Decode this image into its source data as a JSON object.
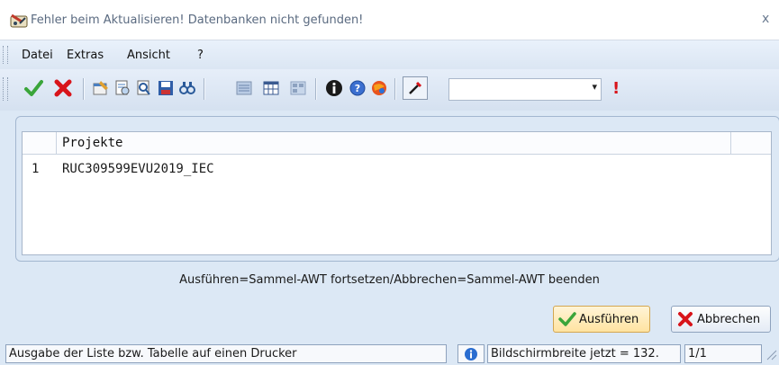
{
  "window": {
    "title": "Fehler beim Aktualisieren! Datenbanken nicht gefunden!",
    "close_glyph": "x"
  },
  "menu": {
    "items": [
      "Datei",
      "Extras",
      "Ansicht",
      "?"
    ]
  },
  "toolbar": {
    "icons": [
      "checkmark-icon",
      "red-x-icon",
      "properties-icon",
      "print-preview-icon",
      "zoom-page-icon",
      "save-icon",
      "find-icon",
      "list-view-icon",
      "table-view-icon",
      "grid-view-icon",
      "info-icon",
      "help-icon",
      "globe-icon",
      "settings-icon"
    ],
    "combo_value": "",
    "exclamation": "!"
  },
  "grid": {
    "column_header": "Projekte",
    "rows": [
      {
        "num": "1",
        "value": "RUC309599EVU2019_IEC"
      }
    ]
  },
  "message": "Ausführen=Sammel-AWT fortsetzen/Abbrechen=Sammel-AWT beenden",
  "buttons": {
    "run": "Ausführen",
    "cancel": "Abbrechen"
  },
  "statusbar": {
    "left": "Ausgabe der Liste bzw. Tabelle auf einen Drucker",
    "screen_width": "Bildschirmbreite jetzt = 132.",
    "page": "1/1"
  },
  "colors": {
    "background": "#dce8f5",
    "accent_orange": "#ffe3a1",
    "red": "#d8141a",
    "green": "#3aa53a"
  }
}
